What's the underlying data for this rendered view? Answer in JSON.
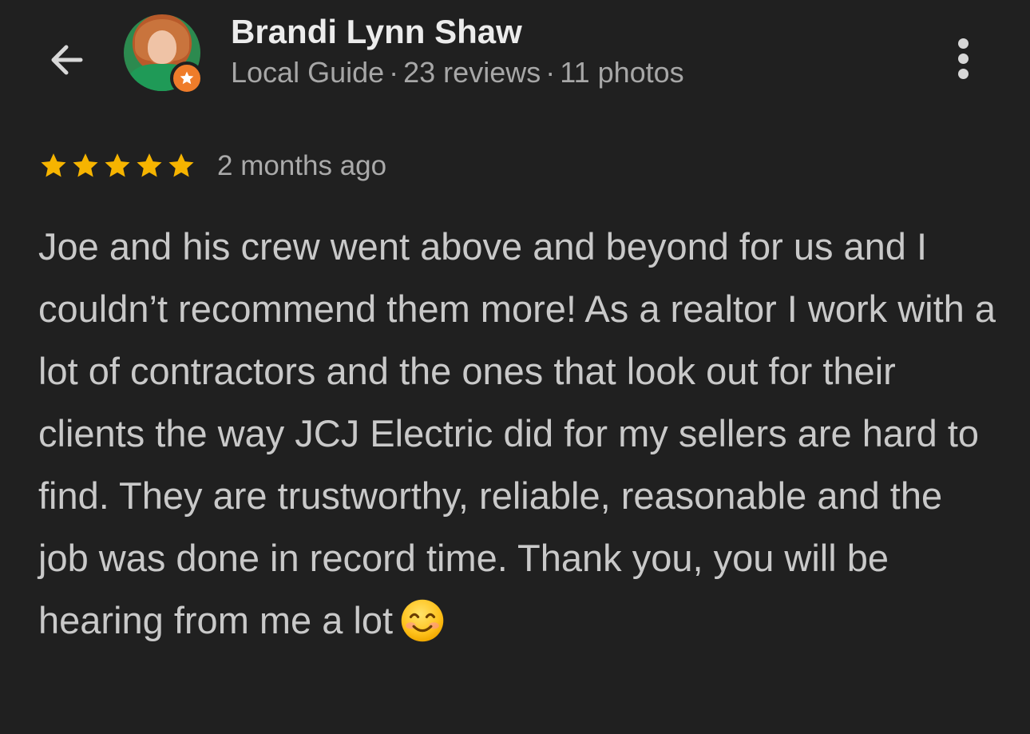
{
  "reviewer": {
    "name": "Brandi Lynn Shaw",
    "role": "Local Guide",
    "reviews": "23 reviews",
    "photos": "11 photos",
    "separator": "·"
  },
  "review": {
    "rating": 5,
    "max_rating": 5,
    "date": "2 months ago",
    "text": "Joe and his crew went above and beyond for us and I couldn’t recommend them more! As a realtor I work with a lot of contractors and the ones that look out for their clients the way JCJ Electric did for my sellers are hard to find. They are trustworthy, reliable, reasonable and the job was done in record time. Thank you, you will be hearing from me a lot"
  },
  "icons": {
    "back": "arrow-back-icon",
    "more": "more-vert-icon",
    "badge": "local-guide-star-icon",
    "star": "star-icon",
    "emoji": "smiling-face-emoji-icon"
  },
  "colors": {
    "background": "#202020",
    "star": "#F6B400",
    "badge": "#EF7C2A",
    "text": "#C9C9C9",
    "muted": "#A7A7A7"
  }
}
